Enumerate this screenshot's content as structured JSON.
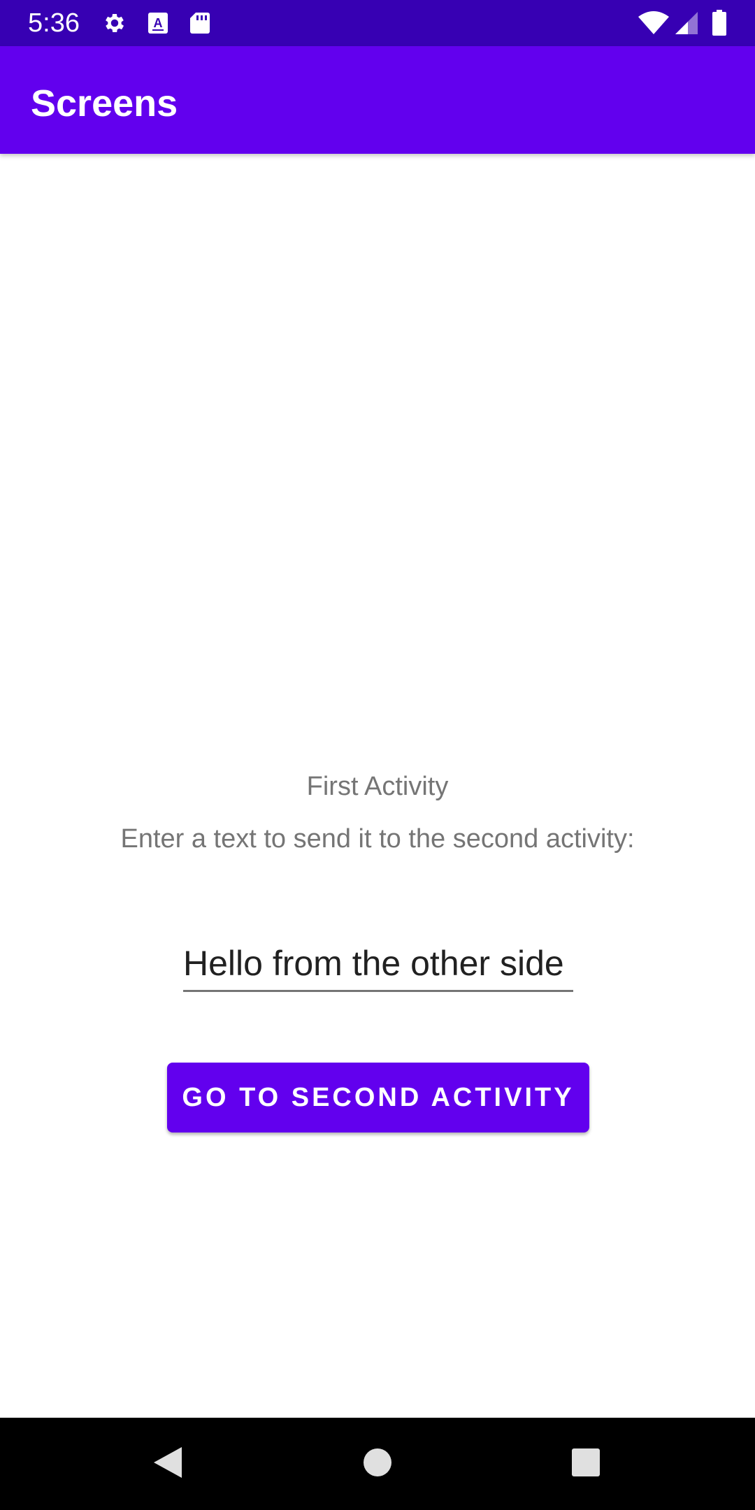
{
  "status_bar": {
    "time": "5:36",
    "left_icons": [
      "settings-icon",
      "keyboard-a-icon",
      "sd-card-icon"
    ],
    "right_icons": [
      "wifi-icon",
      "cell-signal-icon",
      "battery-icon"
    ],
    "background": "#3700B3"
  },
  "app_bar": {
    "title": "Screens",
    "background": "#6200EE"
  },
  "main": {
    "title": "First Activity",
    "hint": "Enter a text to send it to the second activity:",
    "text_input": {
      "value": "Hello from the other side",
      "placeholder": ""
    },
    "button_label": "GO TO SECOND ACTIVITY",
    "accent_color": "#6200EE"
  },
  "nav_bar": {
    "buttons": [
      "back-icon",
      "home-icon",
      "recents-icon"
    ]
  }
}
